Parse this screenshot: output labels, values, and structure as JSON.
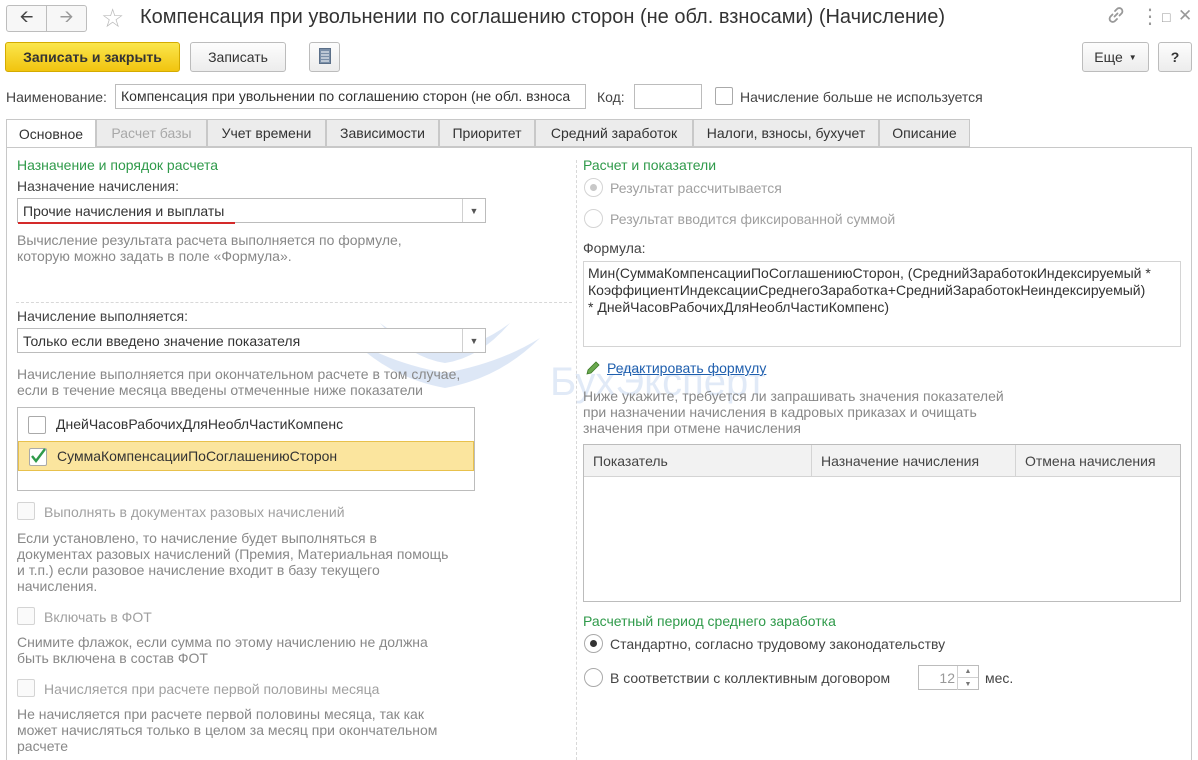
{
  "window": {
    "title": "Компенсация при увольнении по соглашению сторон (не обл. взносами) (Начисление)"
  },
  "toolbar": {
    "save_close": "Записать и закрыть",
    "save": "Записать",
    "more": "Еще",
    "help": "?"
  },
  "header": {
    "name_label": "Наименование:",
    "name_value": "Компенсация при увольнении по соглашению сторон (не обл. взноса",
    "code_label": "Код:",
    "code_value": "",
    "unused_label": "Начисление больше не используется"
  },
  "tabs": [
    {
      "label": "Основное"
    },
    {
      "label": "Расчет базы"
    },
    {
      "label": "Учет времени"
    },
    {
      "label": "Зависимости"
    },
    {
      "label": "Приоритет"
    },
    {
      "label": "Средний заработок"
    },
    {
      "label": "Налоги, взносы, бухучет"
    },
    {
      "label": "Описание"
    }
  ],
  "left": {
    "section_title": "Назначение и порядок расчета",
    "purpose_label": "Назначение начисления:",
    "purpose_value": "Прочие начисления и выплаты",
    "purpose_hint_1": "Вычисление результата расчета выполняется по формуле,",
    "purpose_hint_2": "которую можно задать в поле «Формула».",
    "exec_label": "Начисление выполняется:",
    "exec_value": "Только если введено значение показателя",
    "exec_hint_1": "Начисление выполняется при окончательном расчете в том случае,",
    "exec_hint_2": "если в течение месяца введены отмеченные ниже показатели",
    "indicators": [
      {
        "label": "ДнейЧасовРабочихДляНеоблЧастиКомпенс",
        "checked": false
      },
      {
        "label": "СуммаКомпенсацииПоСоглашениюСторон",
        "checked": true
      }
    ],
    "onetime_label": "Выполнять в документах разовых начислений",
    "onetime_hint_1": "Если установлено, то начисление будет выполняться в",
    "onetime_hint_2": "документах разовых начислений (Премия, Материальная помощь",
    "onetime_hint_3": "и т.п.) если разовое начисление входит в базу текущего",
    "onetime_hint_4": "начисления.",
    "fot_label": "Включать в ФОТ",
    "fot_hint_1": "Снимите флажок, если сумма по этому начислению не должна",
    "fot_hint_2": "быть включена в состав ФОТ",
    "half_label": "Начисляется при расчете первой половины месяца",
    "half_hint_1": "Не начисляется при расчете первой половины месяца, так как",
    "half_hint_2": "может начисляться только в целом за месяц при окончательном",
    "half_hint_3": "расчете"
  },
  "right": {
    "section_title": "Расчет и показатели",
    "radio_calc": "Результат рассчитывается",
    "radio_fixed": "Результат вводится фиксированной суммой",
    "formula_label": "Формула:",
    "formula_line_1": "Мин(СуммаКомпенсацииПоСоглашениюСторон, (СреднийЗаработокИндексируемый *",
    "formula_line_2": "КоэффициентИндексацииСреднегоЗаработка+СреднийЗаработокНеиндексируемый)",
    "formula_line_3": "* ДнейЧасовРабочихДляНеоблЧастиКомпенс)",
    "edit_formula": "Редактировать формулу",
    "req_hint_1": "Ниже укажите, требуется ли запрашивать значения показателей",
    "req_hint_2": "при назначении начисления в кадровых приказах и очищать",
    "req_hint_3": "значения при отмене начисления",
    "table_headers": [
      "Показатель",
      "Назначение начисления",
      "Отмена начисления"
    ],
    "avg_section": "Расчетный период среднего заработка",
    "avg_standard": "Стандартно, согласно трудовому законодательству",
    "avg_collective": "В соответствии с коллективным договором",
    "months_value": "12",
    "months_unit": "мес."
  },
  "watermark": "БухЭксперт",
  "colors": {
    "accent_green": "#2f9a4a",
    "primary_button": "#f1c40f",
    "selection": "#fbe59e",
    "link": "#1f5fae"
  }
}
